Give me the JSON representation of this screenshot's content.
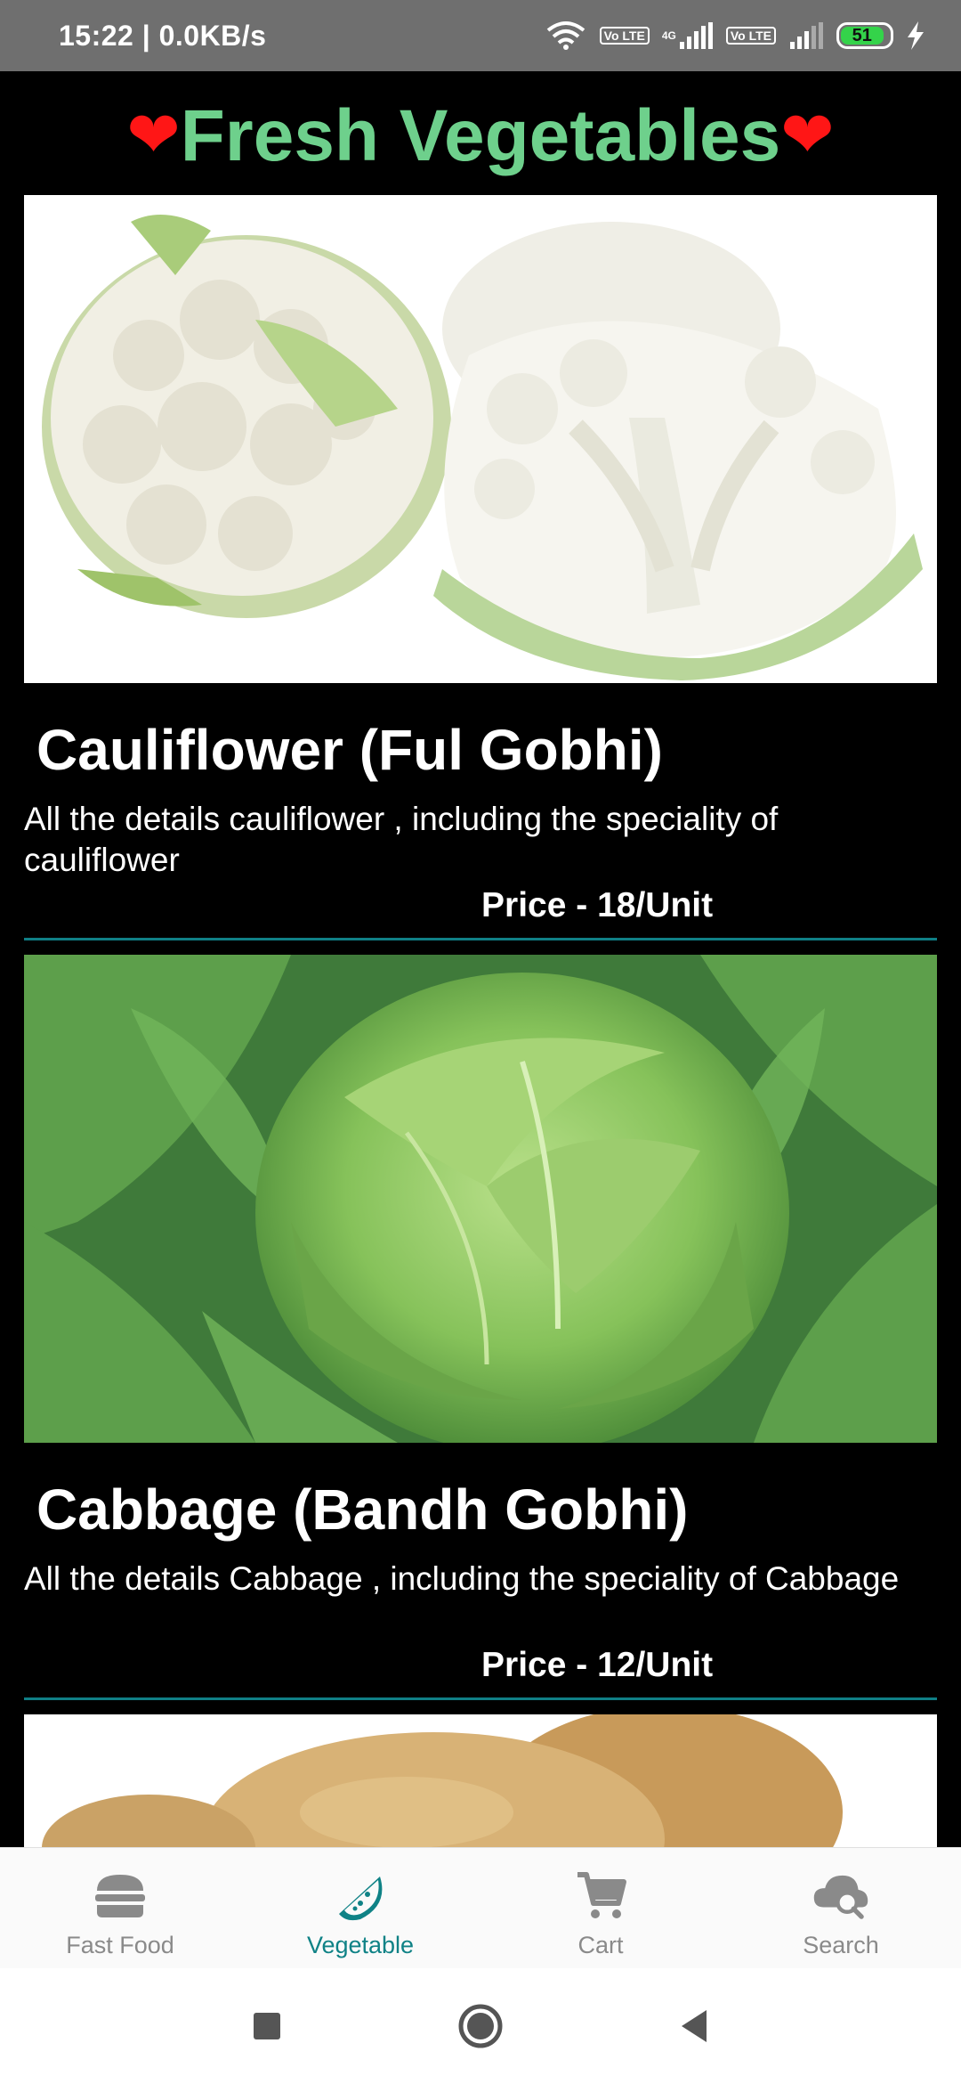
{
  "status_bar": {
    "time_speed": "15:22 | 0.0KB/s",
    "network_4g": "4G",
    "volte_1": "Vo LTE",
    "volte_2": "Vo LTE",
    "battery_level": "51",
    "icons": [
      "wifi-icon",
      "volte-icon",
      "signal-icon",
      "volte-icon",
      "signal-icon",
      "battery-icon",
      "charging-icon"
    ]
  },
  "header": {
    "title": "Fresh Vegetables",
    "heart_left": "❤",
    "heart_right": "❤"
  },
  "products": [
    {
      "name": "Cauliflower (Ful Gobhi)",
      "description": "All the details cauliflower , including the speciality of cauliflower",
      "price": "Price - 18/Unit",
      "image": "cauliflower-image"
    },
    {
      "name": "Cabbage (Bandh Gobhi)",
      "description": "All the details Cabbage , including the speciality of Cabbage",
      "price": "Price - 12/Unit",
      "image": "cabbage-image"
    },
    {
      "image": "potato-image"
    }
  ],
  "bottom_nav": {
    "items": [
      {
        "label": "Fast Food",
        "icon": "burger-icon",
        "active": false
      },
      {
        "label": "Vegetable",
        "icon": "watermelon-icon",
        "active": true
      },
      {
        "label": "Cart",
        "icon": "cart-icon",
        "active": false
      },
      {
        "label": "Search",
        "icon": "cloud-search-icon",
        "active": false
      }
    ]
  },
  "colors": {
    "title_green": "#6ed08c",
    "heart_red": "#ff1616",
    "accent_teal": "#0f8286",
    "background": "#000000",
    "status_bar": "#6f6f6f"
  }
}
